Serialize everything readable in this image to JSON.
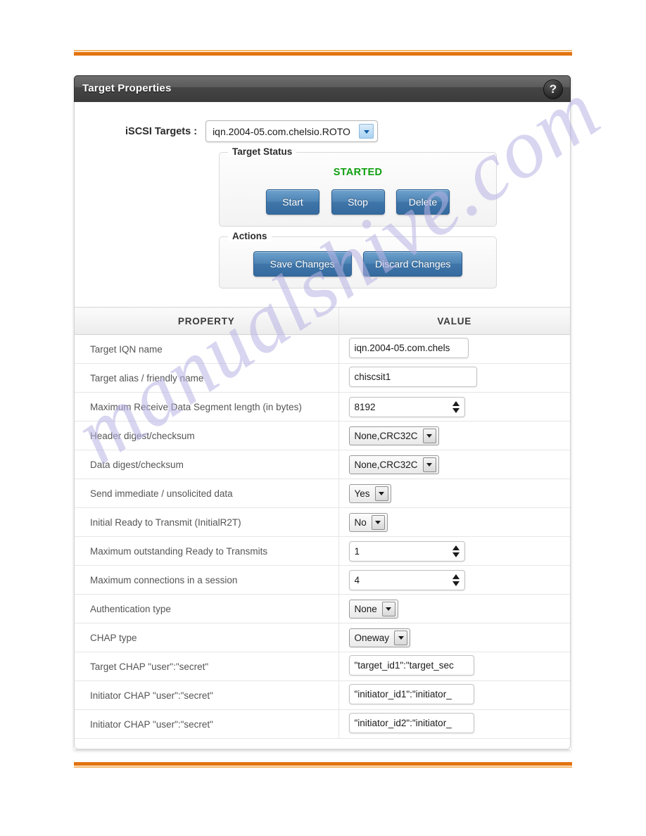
{
  "window": {
    "title": "Target Properties",
    "help_icon_label": "?"
  },
  "form": {
    "targets_label": "iSCSI Targets :",
    "selected_target": "iqn.2004-05.com.chelsio.ROTO"
  },
  "target_status": {
    "legend": "Target Status",
    "status": "STARTED",
    "status_color": "#12a012",
    "buttons": [
      {
        "label": "Start"
      },
      {
        "label": "Stop"
      },
      {
        "label": "Delete"
      }
    ]
  },
  "actions": {
    "legend": "Actions",
    "buttons": [
      {
        "label": "Save Changes"
      },
      {
        "label": "Discard Changes"
      }
    ]
  },
  "table": {
    "headers": {
      "property": "PROPERTY",
      "value": "VALUE"
    },
    "rows": [
      {
        "property": "Target IQN name",
        "widget": "text",
        "value": "iqn.2004-05.com.chels"
      },
      {
        "property": "Target alias / friendly name",
        "widget": "text",
        "value": "chiscsit1"
      },
      {
        "property": "Maximum Receive Data Segment length (in bytes)",
        "widget": "spinner",
        "value": "8192"
      },
      {
        "property": "Header digest/checksum",
        "widget": "select",
        "value": "None,CRC32C"
      },
      {
        "property": "Data digest/checksum",
        "widget": "select",
        "value": "None,CRC32C"
      },
      {
        "property": "Send immediate / unsolicited data",
        "widget": "select",
        "value": "Yes"
      },
      {
        "property": "Initial Ready to Transmit (InitialR2T)",
        "widget": "select",
        "value": "No"
      },
      {
        "property": "Maximum outstanding Ready to Transmits",
        "widget": "spinner",
        "value": "1"
      },
      {
        "property": "Maximum connections in a session",
        "widget": "spinner",
        "value": "4"
      },
      {
        "property": "Authentication type",
        "widget": "select",
        "value": "None"
      },
      {
        "property": "CHAP type",
        "widget": "select",
        "value": "Oneway"
      },
      {
        "property": "Target CHAP \"user\":\"secret\"",
        "widget": "text",
        "value": "\"target_id1\":\"target_sec"
      },
      {
        "property": "Initiator CHAP \"user\":\"secret\"",
        "widget": "text",
        "value": "\"initiator_id1\":\"initiator_"
      },
      {
        "property": "Initiator CHAP \"user\":\"secret\"",
        "widget": "text",
        "value": "\"initiator_id2\":\"initiator_"
      }
    ]
  },
  "page": {
    "watermark": "manualshive.com",
    "rule_color": "#e2730e",
    "rule_color_light": "#f4b569"
  }
}
